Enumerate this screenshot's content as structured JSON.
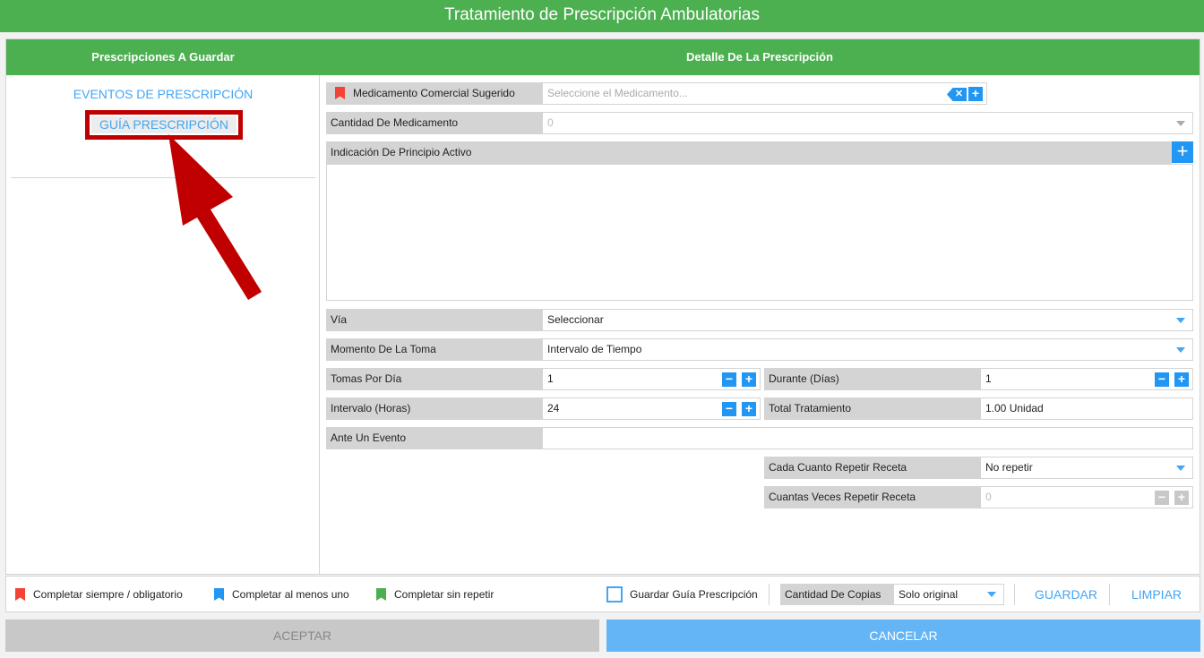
{
  "window": {
    "title": "Tratamiento de Prescripción Ambulatorias"
  },
  "header": {
    "left_title": "Prescripciones A Guardar",
    "right_title": "Detalle De La Prescripción"
  },
  "left_menu": {
    "items": [
      "EVENTOS DE PRESCRIPCIÓN",
      "GUÍA PRESCRIPCIÓN"
    ]
  },
  "form": {
    "medicamento": {
      "label": "Medicamento Comercial Sugerido",
      "placeholder": "Seleccione el Medicamento..."
    },
    "cantidad": {
      "label": "Cantidad De Medicamento",
      "value": "0"
    },
    "indicacion": {
      "label": "Indicación De Principio Activo"
    },
    "via": {
      "label": "Vía",
      "value": "Seleccionar"
    },
    "momento": {
      "label": "Momento De La Toma",
      "value": "Intervalo de Tiempo"
    },
    "tomas": {
      "label": "Tomas Por Día",
      "value": "1"
    },
    "durante": {
      "label": "Durante (Días)",
      "value": "1"
    },
    "intervalo": {
      "label": "Intervalo (Horas)",
      "value": "24"
    },
    "total": {
      "label": "Total Tratamiento",
      "value": "1.00 Unidad"
    },
    "ante_evento": {
      "label": "Ante Un Evento",
      "value": ""
    },
    "cada_cuanto": {
      "label": "Cada Cuanto Repetir Receta",
      "value": "No repetir"
    },
    "cuantas_veces": {
      "label": "Cuantas Veces Repetir Receta",
      "value": "0"
    }
  },
  "legend": {
    "required": "Completar siempre / obligatorio",
    "at_least_one": "Completar al menos uno",
    "no_repeat": "Completar sin repetir",
    "colors": {
      "required": "#f44336",
      "at_least_one": "#2196f3",
      "no_repeat": "#4caf50"
    }
  },
  "footer_options": {
    "guardar_guia": "Guardar Guía Prescripción",
    "copias_label": "Cantidad De Copias",
    "copias_value": "Solo original",
    "guardar": "GUARDAR",
    "limpiar": "LIMPIAR"
  },
  "actions": {
    "aceptar": "ACEPTAR",
    "cancelar": "CANCELAR"
  },
  "theme": {
    "green": "#4caf50",
    "blue": "#2196f3",
    "link_blue": "#42a5f5",
    "annotation_red": "#c00000"
  }
}
